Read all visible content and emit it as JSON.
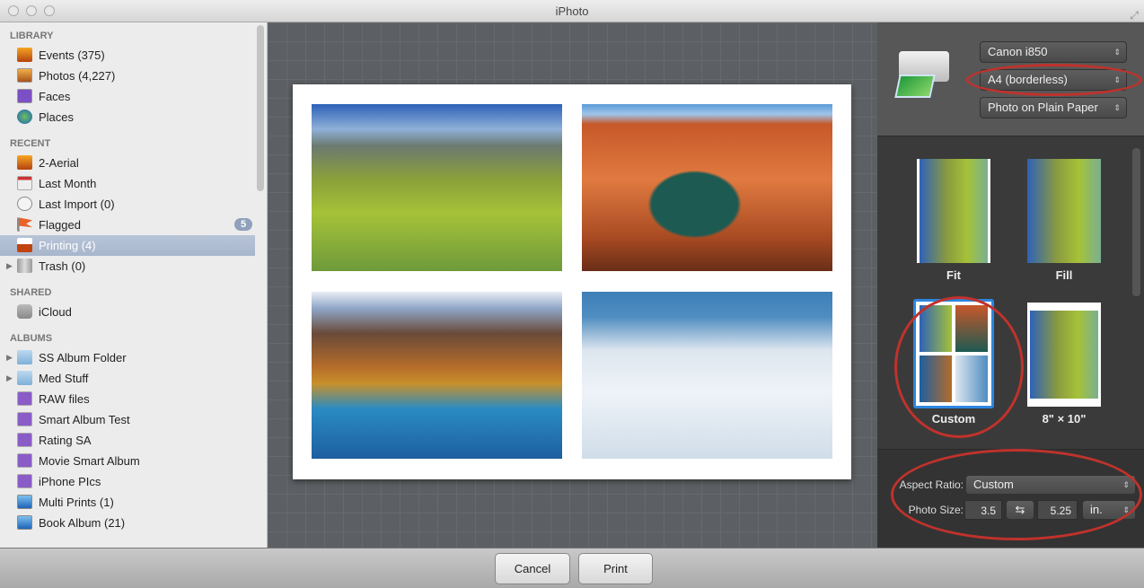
{
  "window": {
    "title": "iPhoto"
  },
  "sidebar": {
    "sections": [
      {
        "title": "LIBRARY",
        "items": [
          {
            "label": "Events (375)"
          },
          {
            "label": "Photos (4,227)"
          },
          {
            "label": "Faces"
          },
          {
            "label": "Places"
          }
        ]
      },
      {
        "title": "RECENT",
        "items": [
          {
            "label": "2-Aerial"
          },
          {
            "label": "Last Month"
          },
          {
            "label": "Last Import (0)"
          },
          {
            "label": "Flagged",
            "badge": "5"
          },
          {
            "label": "Printing (4)",
            "selected": true
          },
          {
            "label": "Trash (0)"
          }
        ]
      },
      {
        "title": "SHARED",
        "items": [
          {
            "label": "iCloud"
          }
        ]
      },
      {
        "title": "ALBUMS",
        "items": [
          {
            "label": "SS Album Folder"
          },
          {
            "label": "Med Stuff"
          },
          {
            "label": "RAW files"
          },
          {
            "label": "Smart Album Test"
          },
          {
            "label": "Rating SA"
          },
          {
            "label": "Movie Smart Album"
          },
          {
            "label": "iPhone PIcs"
          },
          {
            "label": "Multi Prints (1)"
          },
          {
            "label": "Book Album (21)"
          }
        ]
      }
    ]
  },
  "print": {
    "printer": "Canon i850",
    "paper_size": "A4 (borderless)",
    "paper_type": "Photo on Plain Paper",
    "themes": [
      {
        "label": "Fit"
      },
      {
        "label": "Fill"
      },
      {
        "label": "Custom",
        "selected": true
      },
      {
        "label": "8\" × 10\""
      }
    ],
    "aspect_ratio_label": "Aspect Ratio:",
    "aspect_ratio": "Custom",
    "photo_size_label": "Photo Size:",
    "width": "3.5",
    "height": "5.25",
    "unit": "in."
  },
  "buttons": {
    "cancel": "Cancel",
    "print": "Print"
  },
  "colors": {
    "selection": "#a8b6cc",
    "annotation": "#c0322c",
    "theme_selected": "#2d86e0"
  }
}
